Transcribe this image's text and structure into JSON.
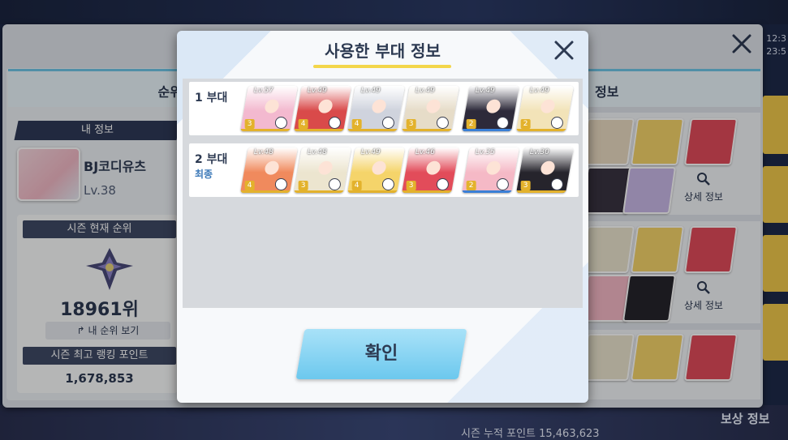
{
  "clock": {
    "line1": "12:3",
    "line2": "23:5"
  },
  "background": {
    "rank_header": "순위",
    "my_info_label": "내 정보",
    "player_name": "BJ코디유츠",
    "player_level": "Lv.38",
    "season_rank_label": "시즌 현재 순위",
    "season_rank_value": "18961위",
    "my_rank_button": "↱ 내 순위 보기",
    "best_points_label": "시즌 최고 랭킹 포인트",
    "best_points_value": "1,678,853",
    "right_header": "정보",
    "detail_button": "상세 정보",
    "cumulative_points": "시즌 누적 포인트   15,463,623",
    "reward_info": "보상 정보"
  },
  "modal": {
    "title": "사용한 부대 정보",
    "confirm_button": "확인",
    "squads": [
      {
        "label": "1 부대",
        "sub": "",
        "members": [
          {
            "level": "Lv.57",
            "stars": "3",
            "color": "#f3b9cf"
          },
          {
            "level": "Lv.49",
            "stars": "4",
            "color": "#d94a4a"
          },
          {
            "level": "Lv.49",
            "stars": "4",
            "color": "#cfd3dd"
          },
          {
            "level": "Lv.49",
            "stars": "3",
            "color": "#e6dcc8"
          },
          {
            "level": "Lv.49",
            "stars": "2",
            "color": "#2d2a3a"
          },
          {
            "level": "Lv.49",
            "stars": "2",
            "color": "#f2e3b8"
          }
        ]
      },
      {
        "label": "2 부대",
        "sub": "최종",
        "members": [
          {
            "level": "Lv.48",
            "stars": "4",
            "color": "#f08a5d"
          },
          {
            "level": "Lv.48",
            "stars": "3",
            "color": "#ece5cf"
          },
          {
            "level": "Lv.49",
            "stars": "4",
            "color": "#f5d46a"
          },
          {
            "level": "Lv.46",
            "stars": "3",
            "color": "#e24c5a"
          },
          {
            "level": "Lv.35",
            "stars": "2",
            "color": "#f5b9c6"
          },
          {
            "level": "Lv.30",
            "stars": "3",
            "color": "#26242c"
          }
        ]
      }
    ]
  }
}
